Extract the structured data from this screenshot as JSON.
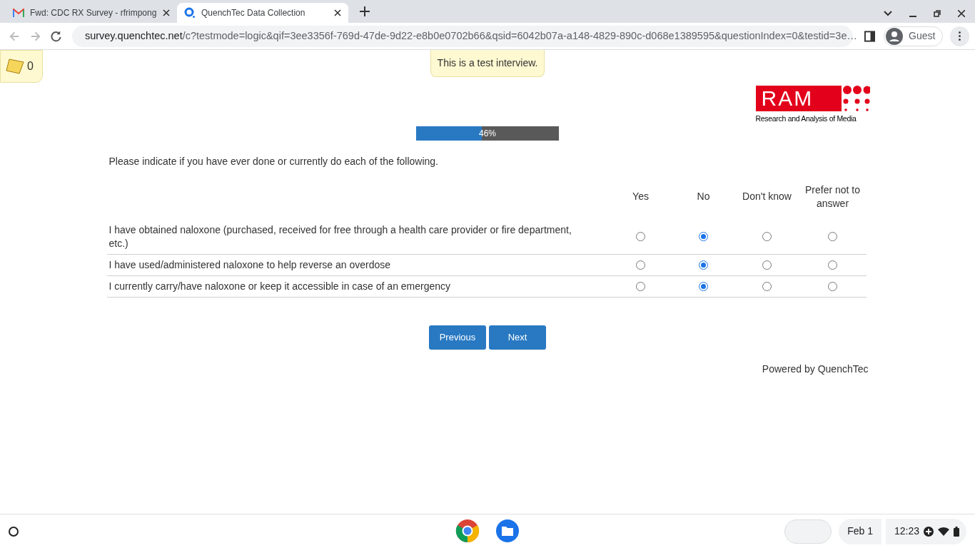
{
  "browser": {
    "tabs": [
      {
        "title": "Fwd: CDC RX Survey - rfrimpong",
        "kind": "mail",
        "selected": false
      },
      {
        "title": "QuenchTec Data Collection",
        "kind": "survey",
        "selected": true
      }
    ],
    "url": {
      "host": "survey.quenchtec.net",
      "path": "/c?testmode=logic&qif=3ee3356f-769d-47de-9d22-e8b0e0702b66&qsid=6042b07a-a148-4829-890c-d068e1389595&questionIndex=0&testid=3e…"
    },
    "profile": "Guest"
  },
  "page": {
    "notes_count": "0",
    "test_banner": "This is a test interview.",
    "logo": {
      "name": "RAM",
      "tagline": "Research and Analysis of Media"
    },
    "progress": {
      "level": 0.46,
      "label": "46%"
    },
    "question": "Please indicate if you have ever done or currently do each of the following.",
    "columns": [
      "Yes",
      "No",
      "Don't know",
      "Prefer not to answer"
    ],
    "rows": [
      {
        "statement": "I have obtained naloxone (purchased, received for free through a health care provider or fire department, etc.)",
        "options": [
          {
            "selected": false
          },
          {
            "selected": true
          },
          {
            "selected": false
          },
          {
            "selected": false
          }
        ]
      },
      {
        "statement": "I have used/administered naloxone to help reverse an overdose",
        "options": [
          {
            "selected": false
          },
          {
            "selected": true
          },
          {
            "selected": false
          },
          {
            "selected": false
          }
        ]
      },
      {
        "statement": "I currently carry/have naloxone or keep it accessible in case of an emergency",
        "options": [
          {
            "selected": false
          },
          {
            "selected": true
          },
          {
            "selected": false
          },
          {
            "selected": false
          }
        ]
      }
    ],
    "buttons": [
      "Previous",
      "Next"
    ],
    "footer": "Powered by QuenchTec"
  },
  "shelf": {
    "date": "Feb 1",
    "time": "12:23"
  }
}
